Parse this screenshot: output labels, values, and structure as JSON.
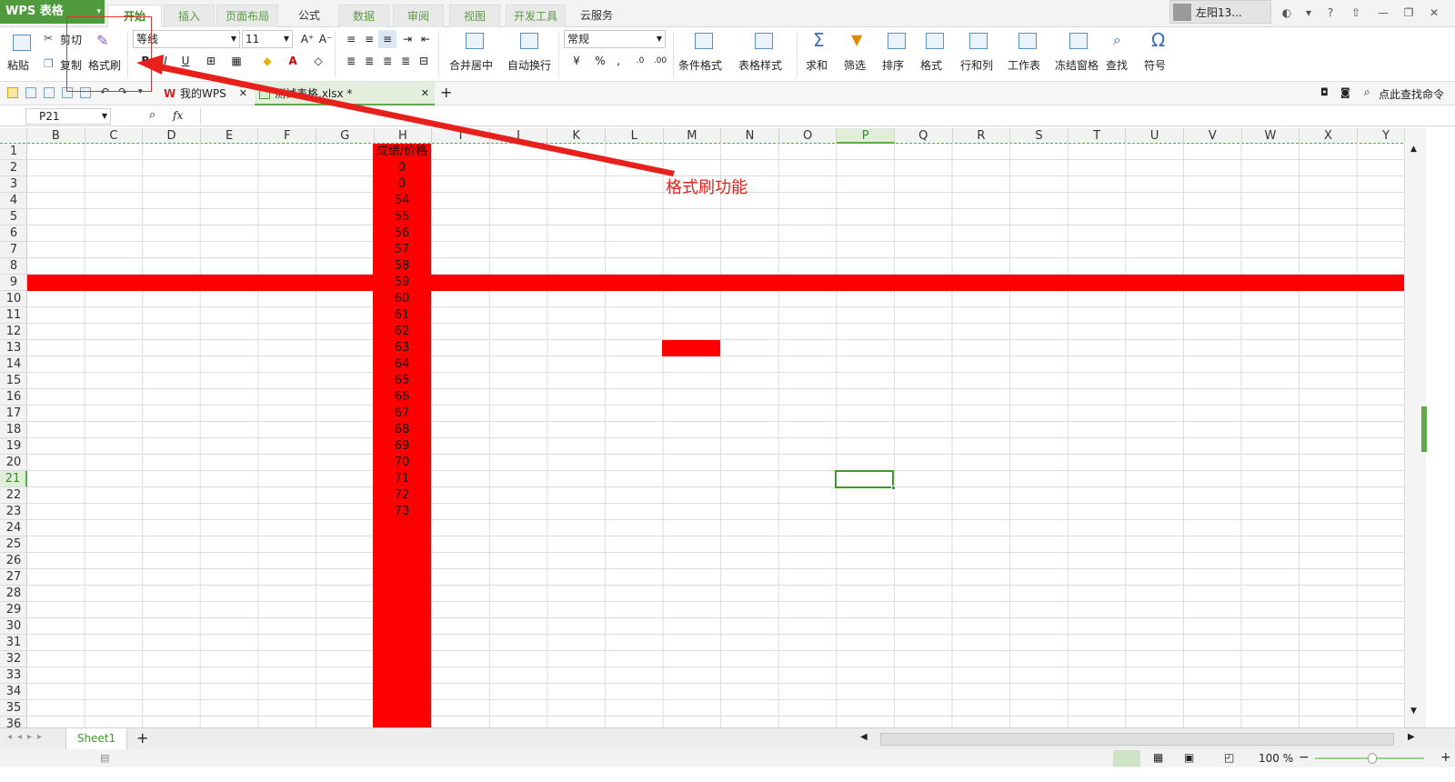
{
  "app": {
    "logo": "WPS 表格",
    "user": "左阳13...",
    "colors": {
      "accent": "#4f9a3c",
      "fill_red": "#ff0000"
    }
  },
  "menu_tabs": [
    "开始",
    "插入",
    "页面布局",
    "公式",
    "数据",
    "审阅",
    "视图",
    "开发工具",
    "云服务"
  ],
  "ribbon": {
    "paste": "粘贴",
    "cut": "剪切",
    "copy": "复制",
    "format_painter": "格式刷",
    "font_name": "等线",
    "font_size": "11",
    "bold": "B",
    "italic": "I",
    "underline": "U",
    "grow_font": "A⁺",
    "shrink_font": "A⁻",
    "merge": "合并居中",
    "wrap": "自动换行",
    "number_format": "常规",
    "percent": "%",
    "comma": ",",
    "cond_format": "条件格式",
    "table_style": "表格样式",
    "sum": "求和",
    "filter": "筛选",
    "sort": "排序",
    "format": "格式",
    "row_col": "行和列",
    "sheet": "工作表",
    "freeze": "冻结窗格",
    "find": "查找",
    "symbol": "符号"
  },
  "doc_tabs": [
    {
      "label": "我的WPS",
      "active": false
    },
    {
      "label": "测试表格.xlsx *",
      "active": true
    }
  ],
  "search_cmd": "点此查找命令",
  "formula_bar": {
    "name_box": "P21",
    "fx": "fx",
    "value": ""
  },
  "columns": [
    "B",
    "C",
    "D",
    "E",
    "F",
    "G",
    "H",
    "I",
    "J",
    "K",
    "L",
    "M",
    "N",
    "O",
    "P",
    "Q",
    "R",
    "S",
    "T",
    "U",
    "V",
    "W",
    "X",
    "Y"
  ],
  "rows": [
    "1",
    "2",
    "3",
    "4",
    "5",
    "6",
    "7",
    "8",
    "9",
    "10",
    "11",
    "12",
    "13",
    "14",
    "15",
    "16",
    "17",
    "18",
    "19",
    "20",
    "21",
    "22",
    "23",
    "24",
    "25",
    "26",
    "27",
    "28",
    "29",
    "30",
    "31",
    "32",
    "33",
    "34",
    "35",
    "36"
  ],
  "selected": {
    "column": "P",
    "row": "21"
  },
  "column_h": {
    "header": "成绩/价格",
    "values": [
      "0",
      "0",
      "54",
      "55",
      "56",
      "57",
      "58",
      "59",
      "60",
      "61",
      "62",
      "63",
      "64",
      "65",
      "66",
      "67",
      "68",
      "69",
      "70",
      "71",
      "72",
      "73"
    ]
  },
  "sheet_tab": "Sheet1",
  "zoom": "100 %",
  "annotation": "格式刷功能"
}
